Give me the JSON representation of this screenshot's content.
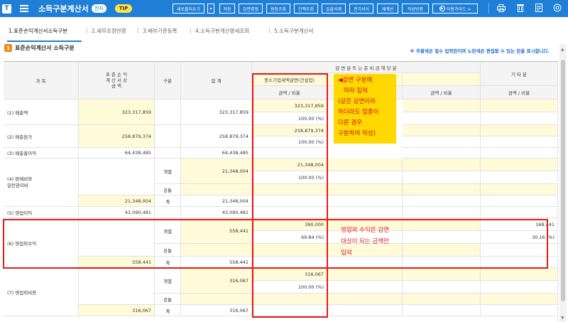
{
  "header": {
    "logo": "T",
    "title": "소득구분계산서",
    "badge_white": "전자",
    "badge_tip": "TIP",
    "buttons": [
      "새로불러오기",
      "저장",
      "감면명형",
      "원장조회",
      "잔액조회",
      "일괄삭제",
      "전기서식",
      "재계산",
      "작성방향"
    ],
    "guide_label": "이용가이드 >"
  },
  "tabs": [
    "1.표준손익계산서소득구분",
    "2.세무조정반영",
    "3.배부기준등록",
    "4.소득구분계산명세조회",
    "5.소득구분계산서"
  ],
  "section": {
    "badge": "1",
    "title": "표준손익계산서 소득구분",
    "note": "※ 주황색은 필수 입력란이며 노란색은 편집할 수 있는 란을 표시합니다."
  },
  "table": {
    "headers": {
      "item": "과 목",
      "standard_line1": "표 준 손 익",
      "standard_line2": "계 산 서 상",
      "standard_line3": "금 액",
      "division": "구분",
      "total": "합 계",
      "reduction_group": "감 면 분 또 는 준 비 금 해 당 분",
      "sme_reduction": "중소기업세액감면(건설업)",
      "amount_ratio": "금액 / 비율",
      "other": "기 타 분"
    },
    "rows": {
      "r1": {
        "label": "(1) 매출액",
        "std": "323,317,859",
        "total": "323,317,859",
        "amt": "323,317,859",
        "ratio": "100.00 (%)"
      },
      "r2": {
        "label": "(2) 매출원가",
        "std": "258,879,374",
        "total": "258,879,374",
        "amt": "258,879,374",
        "ratio": "100.00 (%)"
      },
      "r3": {
        "label": "(3) 매출총이익",
        "std": "64,438,485",
        "total": "64,438,485"
      },
      "r4": {
        "label1": "(4) 판매비와",
        "label2": "일반관리비",
        "div1": "개별",
        "div1_total": "21,348,004",
        "amt": "21,348,004",
        "ratio": "100.00 (%)",
        "div2": "공통",
        "div3": "계",
        "std": "21,348,004",
        "div3_total": "21,348,004"
      },
      "r5": {
        "label": "(5) 영업이익",
        "std": "43,090,481",
        "total": "43,090,481"
      },
      "r6": {
        "label": "(6) 영업외수익",
        "div1": "개별",
        "div1_total": "558,441",
        "amt": "390,000",
        "ratio": "69.84 (%)",
        "other_amt": "168,441",
        "other_ratio": "30.16 (%)",
        "div2": "공통",
        "div3": "계",
        "std": "558,441",
        "div3_total": "558,441"
      },
      "r7": {
        "label": "(7) 영업외비용",
        "div1": "개별",
        "div1_total": "316,067",
        "amt": "316,067",
        "ratio": "100.00 (%)",
        "div2": "공통",
        "div3": "계",
        "std": "316,067",
        "div3_total": "316,067"
      }
    }
  },
  "annotations": {
    "callout1": [
      "◀감면 구분에",
      "따라 입력",
      "(같은 감면이라",
      "하더라도 업종이",
      "다른 경우",
      "구분하여 작성)"
    ],
    "callout2": [
      "영업외 수익은 감면",
      "대상이 되는 금액만",
      "입력"
    ]
  },
  "colors": {
    "primary": "#1f7fd6",
    "yellow": "#fffbd9",
    "red": "#e31b1b",
    "orange": "#f08a1a"
  }
}
